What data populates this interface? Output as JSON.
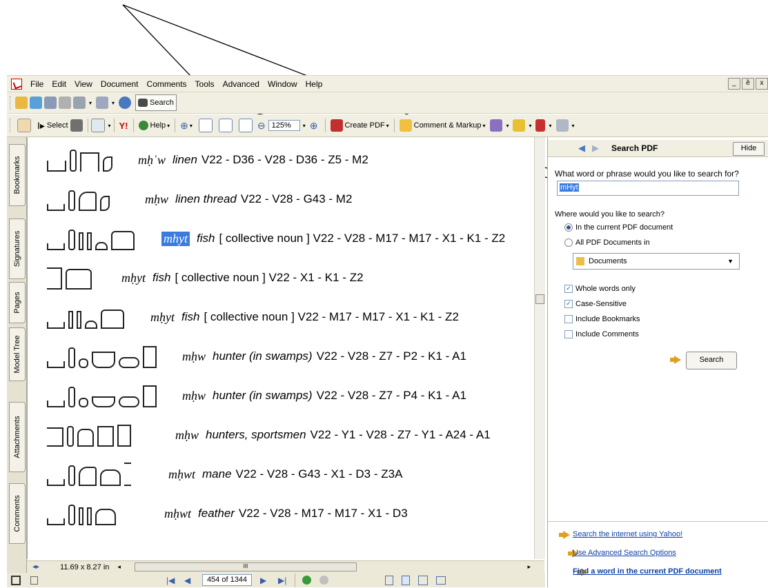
{
  "menu": {
    "items": [
      "File",
      "Edit",
      "View",
      "Document",
      "Comments",
      "Tools",
      "Advanced",
      "Window",
      "Help"
    ],
    "window_buttons": [
      "_",
      "ȅ",
      "x"
    ]
  },
  "toolbar1": {
    "search_label": "Search"
  },
  "toolbar2": {
    "select_label": "Select",
    "help_label": "Help",
    "zoom_value": "125%",
    "create_pdf_label": "Create PDF",
    "comment_markup_label": "Comment & Markup"
  },
  "left_tabs": [
    "Bookmarks",
    "Signatures",
    "Pages",
    "Model Tree",
    "Attachments",
    "Comments"
  ],
  "document": {
    "entries": [
      {
        "translit": "mḥʿw",
        "meaning": "linen",
        "codes": "V22 - D36 - V28 - D36 - Z5 - M2",
        "highlight": false
      },
      {
        "translit": "mḥw",
        "meaning": "linen thread",
        "codes": "V22 - V28 - G43 - M2",
        "highlight": false
      },
      {
        "translit": "mhyt",
        "meaning": "fish",
        "codes": "[ collective noun ] V22 - V28 - M17 - M17 - X1 - K1 - Z2",
        "highlight": true
      },
      {
        "translit": "mḥyt",
        "meaning": "fish",
        "codes": "[ collective noun ] V22 - X1 - K1 - Z2",
        "highlight": false
      },
      {
        "translit": "mḥyt",
        "meaning": "fish",
        "codes": "[ collective noun ] V22 - M17 - M17 - X1 - K1 - Z2",
        "highlight": false
      },
      {
        "translit": "mḥw",
        "meaning": "hunter (in swamps)",
        "codes": "V22 - V28 - Z7 - P2 - K1 - A1",
        "highlight": false
      },
      {
        "translit": "mḥw",
        "meaning": "hunter (in swamps)",
        "codes": "V22 - V28 - Z7 - P4 - K1 - A1",
        "highlight": false
      },
      {
        "translit": "mḥw",
        "meaning": "hunters, sportsmen",
        "codes": "V22 - Y1 - V28 - Z7 - Y1 - A24 - A1",
        "highlight": false
      },
      {
        "translit": "mḥwt",
        "meaning": "mane",
        "codes": "V22 - V28 - G43 - X1 - D3 - Z3A",
        "highlight": false
      },
      {
        "translit": "mḥwt",
        "meaning": "feather",
        "codes": "V22 - V28 - M17 - M17 - X1 - D3",
        "highlight": false
      }
    ]
  },
  "scrollbar": {
    "page_size": "11.69 x 8.27 in",
    "thumb_mark": "III"
  },
  "status": {
    "page_field": "454 of 1344"
  },
  "search_pane": {
    "title": "Search PDF",
    "hide_label": "Hide",
    "question": "What word or phrase would you like to search for?",
    "query": "mHyt",
    "where_label": "Where would you like to search?",
    "option_current": "In the current PDF document",
    "option_all": "All PDF Documents in",
    "location": "Documents",
    "whole_words": "Whole words only",
    "case_sensitive": "Case-Sensitive",
    "include_bookmarks": "Include Bookmarks",
    "include_comments": "Include Comments",
    "search_button": "Search",
    "links": [
      "Search the internet using Yahoo!",
      "Use Advanced Search Options",
      "Find a word in the current PDF document"
    ]
  }
}
